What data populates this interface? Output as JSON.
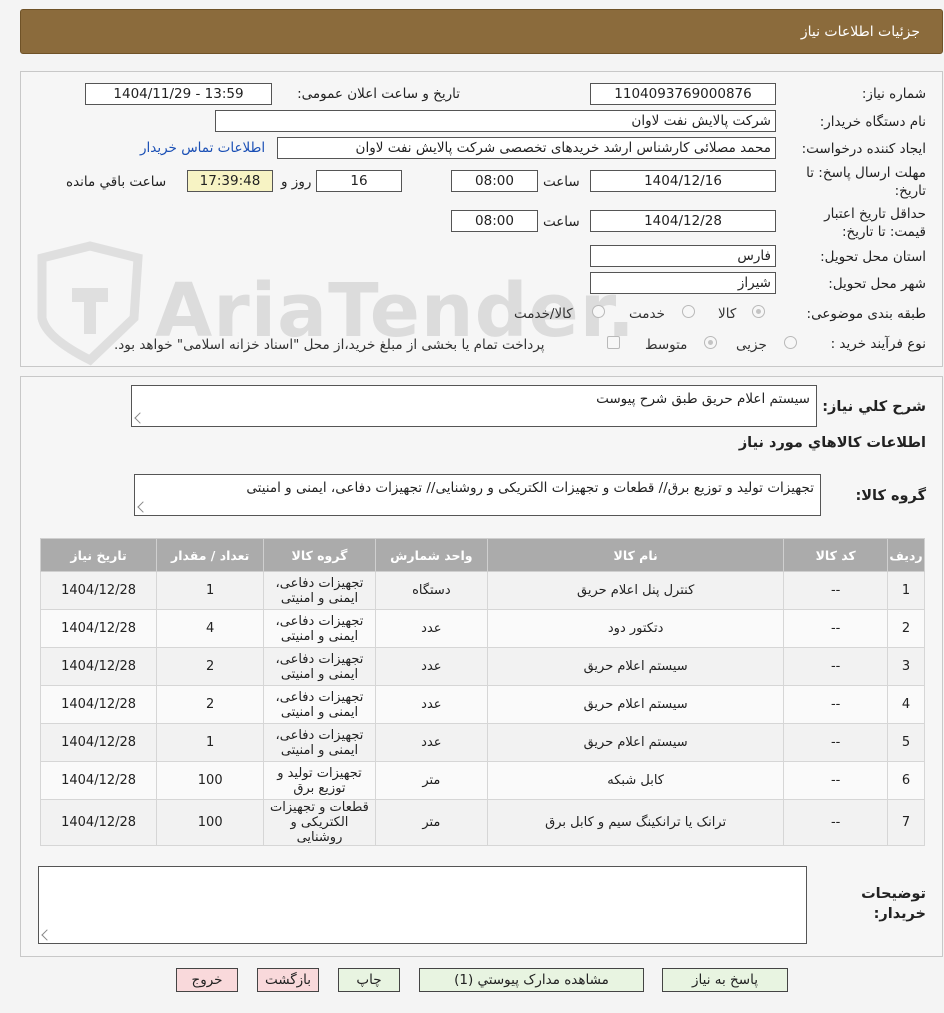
{
  "header": {
    "title": "جزئیات اطلاعات نیاز"
  },
  "info": {
    "need_number_label": "شماره نیاز:",
    "need_number": "1104093769000876",
    "announce_label": "تاریخ و ساعت اعلان عمومی:",
    "announce_value": "1404/11/29 - 13:59",
    "buyer_label": "نام دستگاه خریدار:",
    "buyer_value": "شرکت پالایش نفت لاوان",
    "creator_label": "ایجاد کننده درخواست:",
    "creator_value": "محمد مصلائی کارشناس ارشد خریدهای تخصصی شرکت پالایش نفت لاوان",
    "contact_link": "اطلاعات تماس خریدار",
    "reply_label_1": "مهلت ارسال پاسخ: تا",
    "reply_label_2": "تاریخ:",
    "reply_date": "1404/12/16",
    "time_label": "ساعت",
    "reply_time": "08:00",
    "days_value": "16",
    "day_label": "روز و",
    "remaining_time": "17:39:48",
    "remaining_label": "ساعت باقي مانده",
    "validity_label_1": "حداقل تاریخ اعتبار",
    "validity_label_2": "قیمت: تا تاریخ:",
    "validity_date": "1404/12/28",
    "validity_time": "08:00",
    "province_label": "استان محل تحویل:",
    "province_value": "فارس",
    "city_label": "شهر محل تحویل:",
    "city_value": "شیراز",
    "category_label": "طبقه بندی موضوعی:",
    "category_options": [
      "کالا",
      "خدمت",
      "کالا/خدمت"
    ],
    "process_label": "نوع فرآیند خرید :",
    "process_options": [
      "جزیی",
      "متوسط"
    ],
    "payment_note": "پرداخت تمام یا بخشی از مبلغ خرید،از محل \"اسناد خزانه اسلامی\" خواهد بود."
  },
  "watermark": {
    "text": "AriaTender.neT"
  },
  "description": {
    "label": "شرح کلي نیاز:",
    "value": "سیستم اعلام حریق طبق شرح پیوست",
    "goods_title": "اطلاعات کالاهاي مورد نیاز",
    "group_label": "گروه کالا:",
    "group_value": "تجهیزات تولید و توزیع برق// قطعات و تجهیزات الکتریکی و روشنایی// تجهیزات دفاعی، ایمنی و امنیتی"
  },
  "table": {
    "headers": [
      "ردیف",
      "کد کالا",
      "نام کالا",
      "واحد شمارش",
      "گروه کالا",
      "تعداد / مقدار",
      "تاریخ نیاز"
    ],
    "rows": [
      [
        "1",
        "--",
        "کنترل پنل اعلام حریق",
        "دستگاه",
        "تجهیزات دفاعی، ایمنی و امنیتی",
        "1",
        "1404/12/28"
      ],
      [
        "2",
        "--",
        "دتکتور دود",
        "عدد",
        "تجهیزات دفاعی، ایمنی و امنیتی",
        "4",
        "1404/12/28"
      ],
      [
        "3",
        "--",
        "سیستم اعلام حریق",
        "عدد",
        "تجهیزات دفاعی، ایمنی و امنیتی",
        "2",
        "1404/12/28"
      ],
      [
        "4",
        "--",
        "سیستم اعلام حریق",
        "عدد",
        "تجهیزات دفاعی، ایمنی و امنیتی",
        "2",
        "1404/12/28"
      ],
      [
        "5",
        "--",
        "سیستم اعلام حریق",
        "عدد",
        "تجهیزات دفاعی، ایمنی و امنیتی",
        "1",
        "1404/12/28"
      ],
      [
        "6",
        "--",
        "کابل شبکه",
        "متر",
        "تجهیزات تولید و توزیع برق",
        "100",
        "1404/12/28"
      ],
      [
        "7",
        "--",
        "ترانک یا ترانکینگ سیم و کابل برق",
        "متر",
        "قطعات و تجهیزات الکتریکی و روشنایی",
        "100",
        "1404/12/28"
      ]
    ]
  },
  "notes": {
    "label_1": "توضیحات",
    "label_2": "خریدار:",
    "value": ""
  },
  "buttons": {
    "reply": "پاسخ به نیاز",
    "attachments": "مشاهده مدارک پیوستي (1)",
    "print": "چاپ",
    "back": "بازگشت",
    "exit": "خروج"
  }
}
